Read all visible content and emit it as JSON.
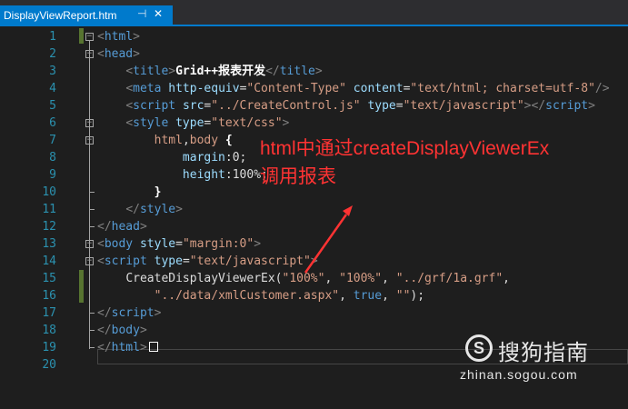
{
  "tab": {
    "title": "DisplayViewReport.htm",
    "pin_icon": "pin-icon",
    "close_icon": "close-icon",
    "pin_glyph": "⊣",
    "close_glyph": "✕"
  },
  "line_numbers": [
    "1",
    "2",
    "3",
    "4",
    "5",
    "6",
    "7",
    "8",
    "9",
    "10",
    "11",
    "12",
    "13",
    "14",
    "15",
    "16",
    "17",
    "18",
    "19",
    "20"
  ],
  "code": {
    "l1": [
      "<",
      "html",
      ">"
    ],
    "l2": [
      "<",
      "head",
      ">"
    ],
    "l3": [
      "<",
      "title",
      ">",
      "Grid++报表开发",
      "</",
      "title",
      ">"
    ],
    "l4": [
      "<",
      "meta",
      " ",
      "http-equiv",
      "=",
      "\"Content-Type\"",
      " ",
      "content",
      "=",
      "\"text/html; charset=utf-8\"",
      "/>"
    ],
    "l5": [
      "<",
      "script",
      " ",
      "src",
      "=",
      "\"../CreateControl.js\"",
      " ",
      "type",
      "=",
      "\"text/javascript\"",
      "></",
      "script",
      ">"
    ],
    "l6": [
      "<",
      "style",
      " ",
      "type",
      "=",
      "\"text/css\"",
      ">"
    ],
    "l7": [
      "html",
      ",",
      "body",
      " {"
    ],
    "l8": [
      "margin",
      ":",
      "0",
      ";"
    ],
    "l9": [
      "height",
      ":",
      "100%",
      ";"
    ],
    "l10": [
      "}"
    ],
    "l11": [
      "</",
      "style",
      ">"
    ],
    "l12": [
      "</",
      "head",
      ">"
    ],
    "l13": [
      "<",
      "body",
      " ",
      "style",
      "=",
      "\"margin:0\"",
      ">"
    ],
    "l14": [
      "<",
      "script",
      " ",
      "type",
      "=",
      "\"text/javascript\"",
      ">"
    ],
    "l15": [
      "CreateDisplayViewerEx(",
      "\"100%\"",
      ", ",
      "\"100%\"",
      ", ",
      "\"../grf/1a.grf\"",
      ","
    ],
    "l16": [
      "\"../data/xmlCustomer.aspx\"",
      ", ",
      "true",
      ", ",
      "\"\"",
      ");"
    ],
    "l17": [
      "</",
      "script",
      ">"
    ],
    "l18": [
      "</",
      "body",
      ">"
    ],
    "l19": [
      "</",
      "html",
      ">"
    ]
  },
  "annotation": {
    "line1": "html中通过createDisplayViewerEx",
    "line2": "调用报表",
    "color": "#ff3333"
  },
  "watermark": {
    "mark": "S",
    "name": "搜狗指南",
    "url": "zhinan.sogou.com"
  },
  "colors": {
    "tab_active": "#007acc",
    "editor_bg": "#1e1e1e",
    "line_number": "#2b91af",
    "tag": "#569cd6",
    "attribute": "#9cdcfe",
    "string": "#d69d85"
  }
}
